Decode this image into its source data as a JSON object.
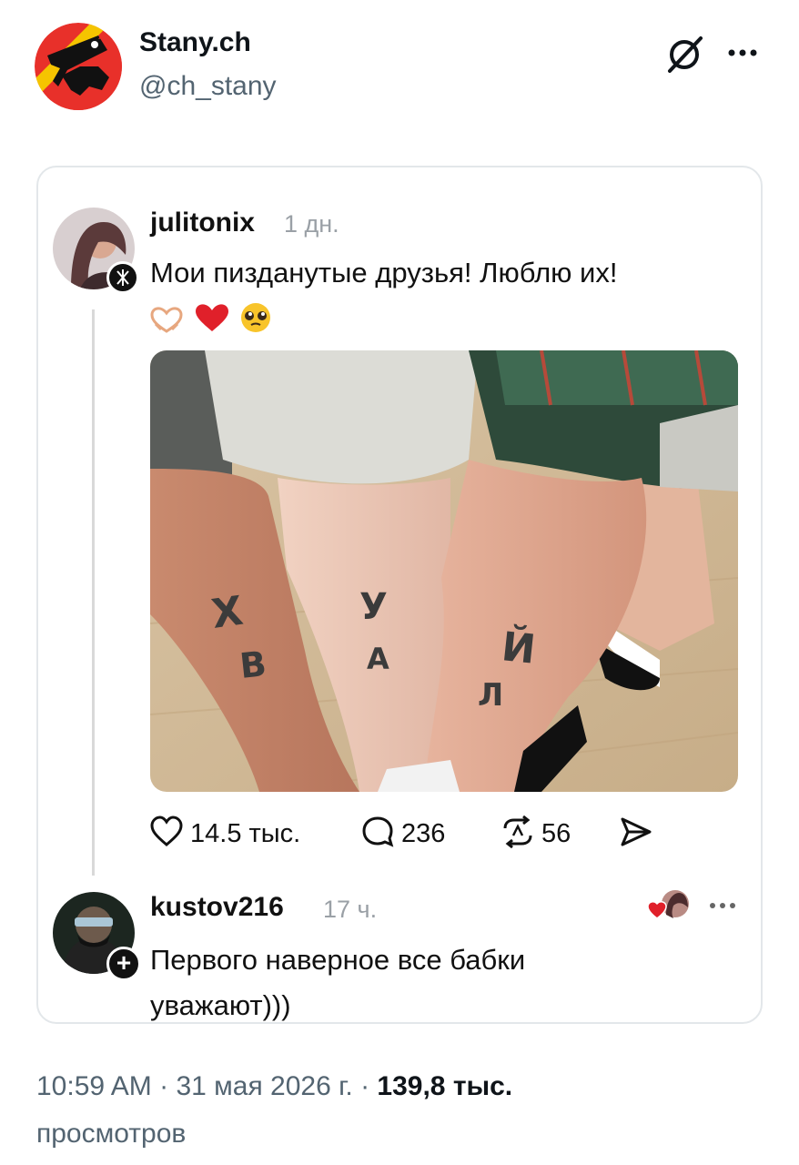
{
  "tweet": {
    "author_name": "Stany.ch",
    "author_handle": "@ch_stany",
    "avatar_icon": "bern-bear-coat-of-arms",
    "menu_icons": [
      "grok-icon",
      "more-icon"
    ]
  },
  "quoted_post": {
    "username": "julitonix",
    "time": "1 дн.",
    "text": "Мои пизданутые друзья! Люблю их!",
    "emojis": [
      "heart-hands-icon",
      "red-heart-icon",
      "pleading-face-icon"
    ],
    "photo": "three-legs-with-letter-tattoos",
    "actions": {
      "likes": "14.5 тыс.",
      "replies": "236",
      "reposts": "56"
    }
  },
  "reply": {
    "username": "kustov216",
    "time": "17 ч.",
    "text": "Первого наверное все бабки уважают)))"
  },
  "footer": {
    "time": "10:59 AM",
    "date": "31 мая 2026 г.",
    "separator": " · ",
    "views_count": "139,8 тыс.",
    "views_label": "просмотров"
  },
  "colors": {
    "text_primary": "#0f1419",
    "text_secondary": "#536471",
    "card_border": "#e3e7ea",
    "bern_red": "#e8302a",
    "bern_yellow": "#f5c400"
  }
}
